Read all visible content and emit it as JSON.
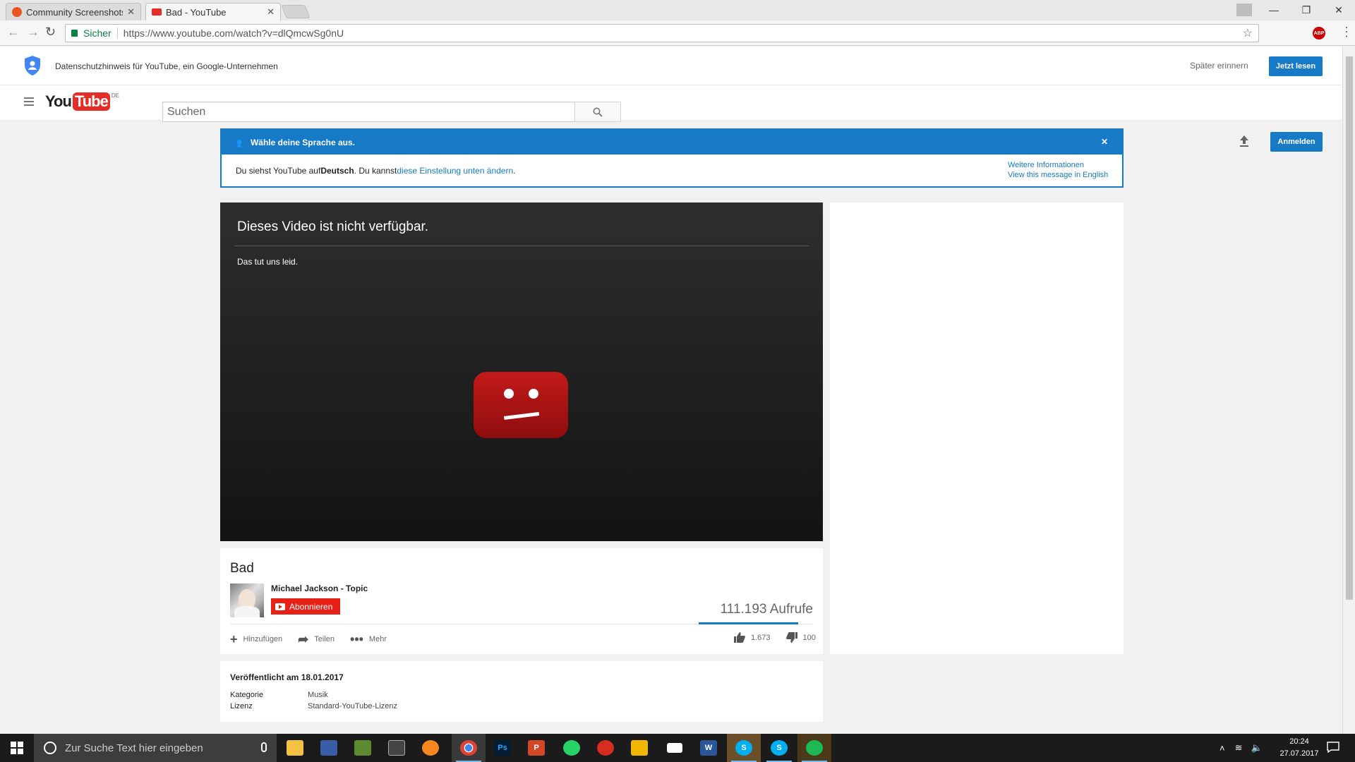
{
  "browser": {
    "tabs": [
      {
        "title": "Community Screenshots"
      },
      {
        "title": "Bad - YouTube"
      }
    ],
    "address": {
      "secure_label": "Sicher",
      "url": "https://www.youtube.com/watch?v=dlQmcwSg0nU"
    },
    "extension_label": "ABP"
  },
  "privacy": {
    "text": "Datenschutzhinweis für YouTube, ein Google-Unternehmen",
    "later": "Später erinnern",
    "read_now": "Jetzt lesen"
  },
  "masthead": {
    "logo_you": "You",
    "logo_tube": "Tube",
    "country_code": "DE",
    "search_placeholder": "Suchen",
    "signin": "Anmelden"
  },
  "language": {
    "title": "Wähle deine Sprache aus.",
    "body_prefix": "Du siehst YouTube auf ",
    "body_lang": "Deutsch",
    "body_mid": ". Du kannst ",
    "body_link": "diese Einstellung unten ändern",
    "body_suffix": ".",
    "more_info": "Weitere Informationen",
    "english": "View this message in English"
  },
  "player": {
    "error_title": "Dieses Video ist nicht verfügbar.",
    "error_sub": "Das tut uns leid."
  },
  "video": {
    "title": "Bad",
    "channel": "Michael Jackson - Topic",
    "subscribe": "Abonnieren",
    "views": "111.193 Aufrufe",
    "add": "Hinzufügen",
    "share": "Teilen",
    "more": "Mehr",
    "likes": "1.673",
    "dislikes": "100",
    "like_ratio": 0.94
  },
  "details": {
    "published": "Veröffentlicht am 18.01.2017",
    "category_label": "Kategorie",
    "category_value": "Musik",
    "license_label": "Lizenz",
    "license_value": "Standard-YouTube-Lizenz"
  },
  "taskbar": {
    "search_placeholder": "Zur Suche Text hier eingeben",
    "time": "20:24",
    "date": "27.07.2017"
  }
}
